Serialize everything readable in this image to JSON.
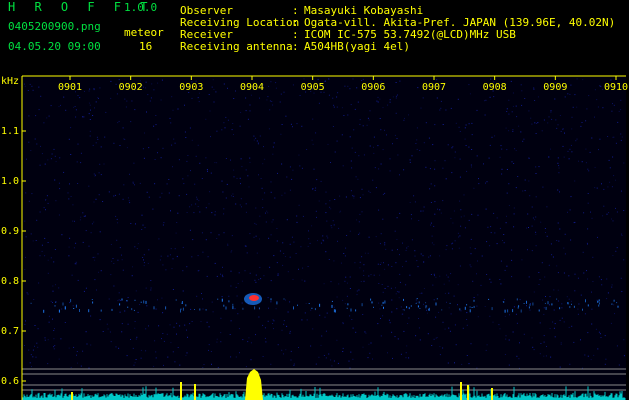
{
  "header": {
    "app_title": "H R O F F T",
    "app_version": "1.0.0",
    "file_name": "0405200900.png",
    "datetime": "04.05.20 09:00",
    "meteor_label": "meteor",
    "meteor_count": "16"
  },
  "info": [
    {
      "label": "Observer",
      "value": "Masayuki Kobayashi"
    },
    {
      "label": "Receiving Location",
      "value": "Ogata-vill. Akita-Pref. JAPAN (139.96E, 40.02N)"
    },
    {
      "label": "Receiver",
      "value": "ICOM IC-575 53.7492(@LCD)MHz USB"
    },
    {
      "label": "Receiving antenna",
      "value": "A504HB(yagi 4el)"
    }
  ],
  "info_separator": ":",
  "spectrogram": {
    "y_unit": "kHz",
    "time_labels": [
      "0901",
      "0902",
      "0903",
      "0904",
      "0905",
      "0906",
      "0907",
      "0908",
      "0909",
      "0910"
    ],
    "freq_labels": [
      "1.1",
      "1.0",
      "0.9",
      "0.8",
      "0.7",
      "0.6"
    ],
    "colors": {
      "text": "#ffff00",
      "header_green": "#00e040",
      "background": "#000010",
      "noise": "#1a2ad0",
      "echo": "#2080ff",
      "spike": "#ffff00",
      "meteor_hot": "#ff3030",
      "line_grid": "#8a8a8a"
    }
  }
}
